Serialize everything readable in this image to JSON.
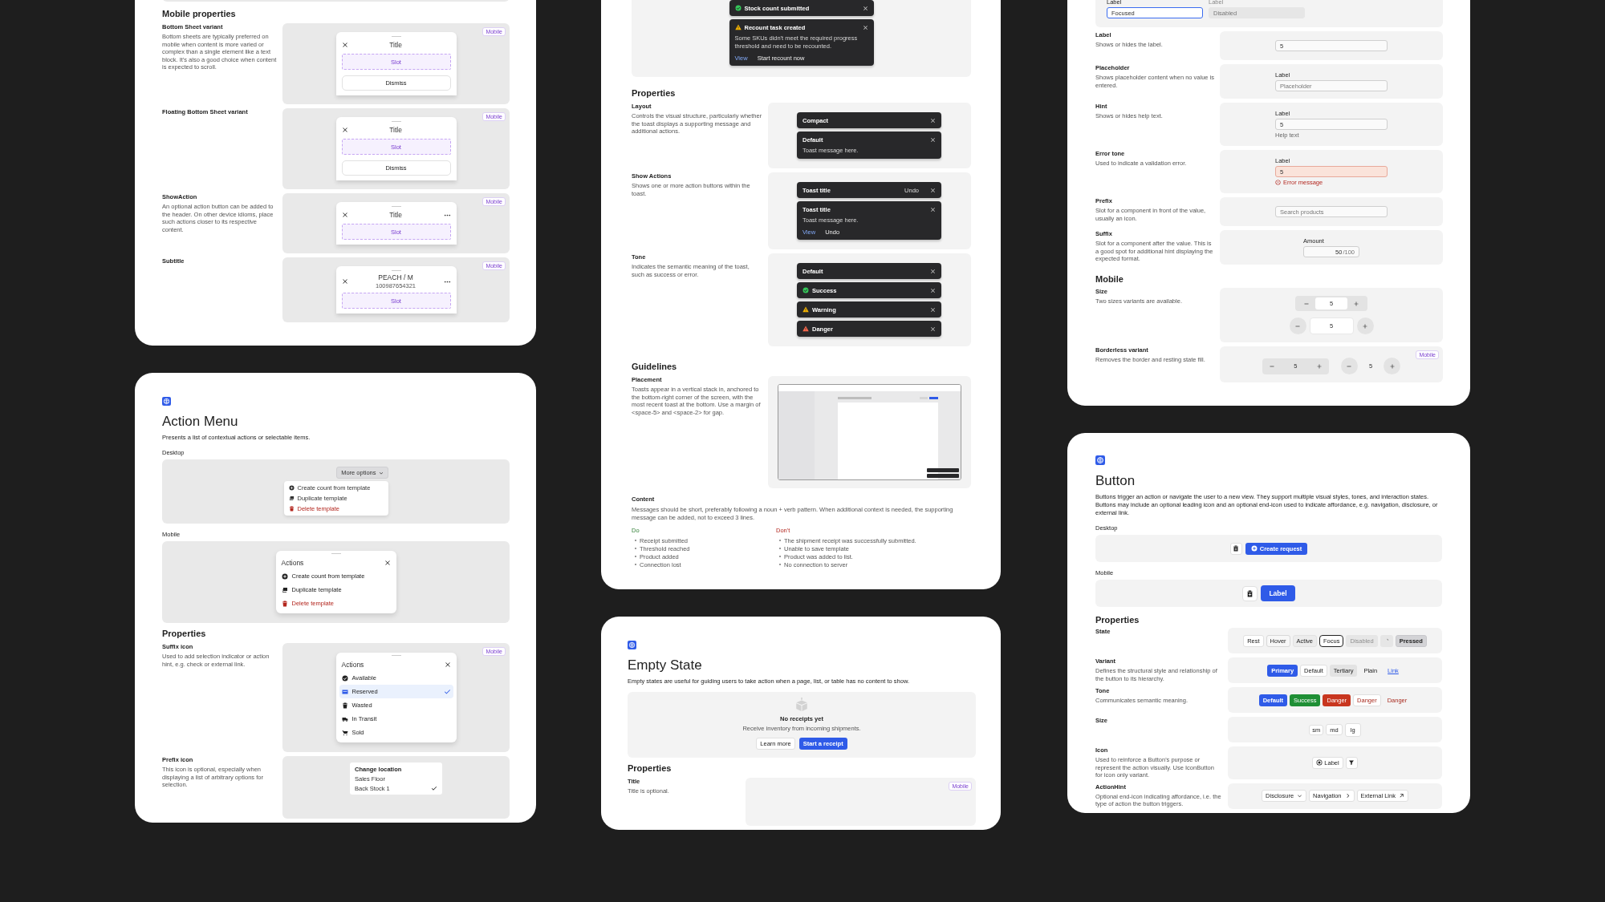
{
  "bottom_sheet_page": {
    "heading": "Mobile properties",
    "properties": [
      {
        "name": "Bottom Sheet variant",
        "description": "Bottom sheets are typically preferred on mobile when content is more varied or complex than a single element like a text block. It's also a good choice when content is expected to scroll.",
        "badge": "Mobile",
        "sheet": {
          "title": "Title",
          "slot": "Slot",
          "dismiss": "Dismiss",
          "show_action": false
        }
      },
      {
        "name": "Floating Bottom Sheet variant",
        "badge": "Mobile",
        "sheet": {
          "title": "Title",
          "slot": "Slot",
          "dismiss": "Dismiss",
          "show_action": false
        }
      },
      {
        "name": "ShowAction",
        "description": "An optional action button can be added to the header. On other device idioms, place such actions closer to its respective content.",
        "badge": "Mobile",
        "sheet": {
          "title": "Title",
          "slot": "Slot",
          "show_action": true
        }
      },
      {
        "name": "Subtitle",
        "badge": "Mobile",
        "sheet": {
          "title": "PEACH / M",
          "subtitle": "100987654321",
          "slot": "Slot",
          "show_action": true
        }
      }
    ]
  },
  "action_menu_page": {
    "title": "Action Menu",
    "description": "Presents a list of contextual actions or selectable items.",
    "desktop": {
      "label": "Desktop",
      "trigger": "More options",
      "items": [
        {
          "label": "Create count from template",
          "danger": false
        },
        {
          "label": "Duplicate template",
          "danger": false
        },
        {
          "label": "Delete template",
          "danger": true
        }
      ]
    },
    "mobile": {
      "label": "Mobile",
      "title": "Actions",
      "items": [
        {
          "label": "Create count from template",
          "danger": false
        },
        {
          "label": "Duplicate template",
          "danger": false
        },
        {
          "label": "Delete template",
          "danger": true
        }
      ]
    },
    "properties_heading": "Properties",
    "suffix_icon": {
      "name": "Suffix icon",
      "description": "Used to add selection indicator or action hint, e.g. check or external link.",
      "badge": "Mobile",
      "menu_title": "Actions",
      "items": [
        {
          "label": "Available",
          "selected": false
        },
        {
          "label": "Reserved",
          "selected": true
        },
        {
          "label": "Wasted",
          "selected": false
        },
        {
          "label": "In Transit",
          "selected": false
        },
        {
          "label": "Sold",
          "selected": false
        }
      ]
    },
    "prefix_icon": {
      "name": "Prefix icon",
      "description": "This icon is optional, especially when displaying a list of arbitrary options for selection.",
      "menu_title": "Change location",
      "items": [
        {
          "label": "Sales Floor",
          "selected": false
        },
        {
          "label": "Back Stock 1",
          "selected": true
        }
      ]
    }
  },
  "toast_page": {
    "demo": [
      {
        "title": "Stock count submitted",
        "kind": "success"
      },
      {
        "title": "Recount task created",
        "kind": "warning",
        "message": "Some SKUs didn't meet the required progress threshold and need to be recounted.",
        "actions": [
          {
            "label": "View",
            "kind": "link"
          },
          {
            "label": "Start recount now",
            "kind": "plain"
          }
        ]
      }
    ],
    "properties_heading": "Properties",
    "properties": [
      {
        "name": "Layout",
        "description": "Controls the visual structure, particularly whether the toast displays a supporting message and additional actions.",
        "toasts": [
          {
            "title": "Compact",
            "kind": "neutral"
          },
          {
            "title": "Default",
            "kind": "neutral",
            "message": "Toast message here."
          }
        ]
      },
      {
        "name": "Show Actions",
        "description": "Shows one or more action buttons within the toast.",
        "toasts": [
          {
            "title": "Toast title",
            "kind": "neutral",
            "inline_action": "Undo"
          },
          {
            "title": "Toast title",
            "kind": "neutral",
            "message": "Toast message here.",
            "actions": [
              {
                "label": "View",
                "kind": "link"
              },
              {
                "label": "Undo",
                "kind": "plain"
              }
            ]
          }
        ]
      },
      {
        "name": "Tone",
        "description": "Indicates the semantic meaning of the toast, such as success or error.",
        "toasts": [
          {
            "title": "Default",
            "kind": "neutral"
          },
          {
            "title": "Success",
            "kind": "success"
          },
          {
            "title": "Warning",
            "kind": "warning"
          },
          {
            "title": "Danger",
            "kind": "danger"
          }
        ]
      }
    ],
    "guidelines": {
      "heading": "Guidelines",
      "placement": {
        "name": "Placement",
        "description": "Toasts appear in a vertical stack in, anchored to the bottom-right corner of the screen, with the most recent toast at the bottom. Use a margin of <space-5> and <space-2> for gap."
      },
      "content": {
        "name": "Content",
        "description": "Messages should be short, preferably following a noun + verb pattern. When additional context is needed, the supporting message can be added, not to exceed 3 lines.",
        "do": {
          "label": "Do",
          "items": [
            "Receipt submitted",
            "Threshold reached",
            "Product added",
            "Connection lost"
          ]
        },
        "dont": {
          "label": "Don't",
          "items": [
            "The shipment receipt was successfully submitted.",
            "Unable to save template",
            "Product was added to list.",
            "No connection to server"
          ]
        }
      }
    }
  },
  "empty_state_page": {
    "title": "Empty State",
    "description": "Empty states are useful for guiding users to take action when a page, list, or table has no content to show.",
    "demo": {
      "title": "No receipts yet",
      "message": "Receive inventory from incoming shipments.",
      "secondary": "Learn more",
      "primary": "Start a receipt"
    },
    "properties_heading": "Properties",
    "properties": [
      {
        "name": "Title",
        "description": "Title is optional.",
        "badge": "Mobile"
      }
    ]
  },
  "text_field_page": {
    "top_fields": [
      {
        "label": "Label",
        "value": "Focused",
        "focused": true,
        "disabled": false
      },
      {
        "label": "Label",
        "value": "Disabled",
        "focused": false,
        "disabled": true
      }
    ],
    "properties": [
      {
        "name": "Label",
        "description": "Shows or hides the label.",
        "field": {
          "value": "5"
        }
      },
      {
        "name": "Placeholder",
        "description": "Shows placeholder content when no value is entered.",
        "field": {
          "label": "Label",
          "placeholder": "Placeholder"
        }
      },
      {
        "name": "Hint",
        "description": "Shows or hides help text.",
        "field": {
          "label": "Label",
          "value": "5",
          "hint": "Help text"
        }
      },
      {
        "name": "Error tone",
        "description": "Used to indicate a validation error.",
        "field": {
          "label": "Label",
          "value": "5",
          "error": "Error message"
        }
      },
      {
        "name": "Prefix",
        "description": "Slot for a component in front of the value, usually an icon.",
        "field": {
          "placeholder": "Search products"
        }
      },
      {
        "name": "Suffix",
        "description": "Slot for a component after the value. This is a good spot for additional hint displaying the expected format.",
        "field": {
          "label": "Amount",
          "value": "50",
          "suffix": "/100"
        }
      }
    ],
    "mobile_heading": "Mobile",
    "mobile": [
      {
        "name": "Size",
        "description": "Two sizes variants are available.",
        "steppers": [
          {
            "value": "5",
            "kind": "compact"
          },
          {
            "value": "5",
            "kind": "large"
          }
        ]
      },
      {
        "name": "Borderless variant",
        "description": "Removes the border and resting state fill.",
        "badge": "Mobile",
        "steppers": [
          {
            "value": "5",
            "kind": "borderless-compact"
          },
          {
            "value": "5",
            "kind": "borderless-large"
          }
        ]
      }
    ]
  },
  "button_page": {
    "title": "Button",
    "description": "Buttons trigger an action or navigate the user to a new view. They support multiple visual styles, tones, and interaction states. Buttons may include an optional leading icon and an optional end-icon used to indicate affordance, e.g. navigation, disclosure, or external link.",
    "desktop": {
      "label": "Desktop",
      "primary": "Create request"
    },
    "mobile": {
      "label": "Mobile",
      "primary": "Label"
    },
    "properties_heading": "Properties",
    "properties": [
      {
        "name": "State",
        "buttons": [
          {
            "label": "Rest",
            "kind": "rest"
          },
          {
            "label": "Hover",
            "kind": "hover"
          },
          {
            "label": "Active",
            "kind": "active"
          },
          {
            "label": "Focus",
            "kind": "focus"
          },
          {
            "label": "Disabled",
            "kind": "disabled"
          },
          {
            "kind": "loading"
          },
          {
            "label": "Pressed",
            "kind": "pressed"
          }
        ]
      },
      {
        "name": "Variant",
        "description": "Defines the structural style and relationship of the button to its hierarchy.",
        "buttons": [
          {
            "label": "Primary",
            "kind": "primary"
          },
          {
            "label": "Default",
            "kind": "default"
          },
          {
            "label": "Tertiary",
            "kind": "tertiary"
          },
          {
            "label": "Plain",
            "kind": "plain"
          },
          {
            "label": "Link",
            "kind": "link"
          }
        ]
      },
      {
        "name": "Tone",
        "description": "Communicates semantic meaning.",
        "buttons": [
          {
            "label": "Default",
            "kind": "primary"
          },
          {
            "label": "Success",
            "kind": "success"
          },
          {
            "label": "Danger",
            "kind": "danger"
          },
          {
            "label": "Danger",
            "kind": "danger-outline"
          },
          {
            "label": "Danger",
            "kind": "danger-plain"
          }
        ]
      },
      {
        "name": "Size",
        "buttons": [
          {
            "label": "sm",
            "kind": "size-sm"
          },
          {
            "label": "md",
            "kind": "size-md"
          },
          {
            "label": "lg",
            "kind": "size-lg"
          }
        ]
      },
      {
        "name": "Icon",
        "description": "Used to reinforce a Button's purpose or represent the action visually. Use IconButton for icon only variant.",
        "buttons": [
          {
            "label": "Label",
            "kind": "icon-label"
          },
          {
            "kind": "icon-only"
          }
        ]
      },
      {
        "name": "ActionHint",
        "description": "Optional end-icon indicating affordance, i.e. the type of action the button triggers.",
        "buttons": [
          {
            "label": "Disclosure",
            "kind": "disclosure"
          },
          {
            "label": "Navigation",
            "kind": "navigation"
          },
          {
            "label": "External Link",
            "kind": "external"
          }
        ]
      }
    ]
  }
}
